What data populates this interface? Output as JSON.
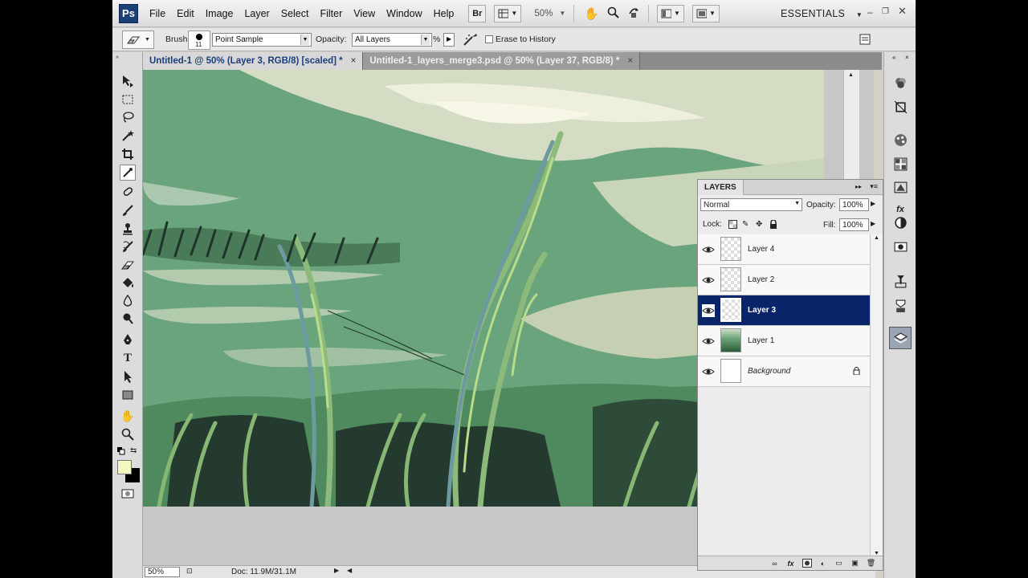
{
  "app": {
    "logo": "Ps",
    "workspace": "ESSENTIALS"
  },
  "menu": [
    "File",
    "Edit",
    "Image",
    "Layer",
    "Select",
    "Filter",
    "View",
    "Window",
    "Help"
  ],
  "appbar": {
    "bridge_label": "Br",
    "zoom": "50%"
  },
  "options": {
    "brush_label": "Brush:",
    "brush_size": "11",
    "sample_value": "Point Sample",
    "opacity_label": "Opacity:",
    "opacity_value": "All Layers",
    "opacity_unit": "%",
    "erase_history_label": "Erase to History"
  },
  "tabs": [
    {
      "label": "Untitled-1 @ 50% (Layer 3, RGB/8) [scaled] *",
      "close": "×"
    },
    {
      "label": "Untitled-1_layers_merge3.psd @ 50% (Layer 37, RGB/8) *",
      "close": "×"
    }
  ],
  "status": {
    "zoom": "50%",
    "doc": "Doc: 11.9M/31.1M"
  },
  "layers_panel": {
    "title": "LAYERS",
    "blend_mode": "Normal",
    "opacity_label": "Opacity:",
    "opacity": "100%",
    "lock_label": "Lock:",
    "fill_label": "Fill:",
    "fill": "100%",
    "layers": [
      {
        "name": "Layer 4",
        "selected": false,
        "thumb": "checker",
        "italic": false,
        "locked": false
      },
      {
        "name": "Layer 2",
        "selected": false,
        "thumb": "checker",
        "italic": false,
        "locked": false
      },
      {
        "name": "Layer 3",
        "selected": true,
        "thumb": "checker",
        "italic": false,
        "locked": false
      },
      {
        "name": "Layer 1",
        "selected": false,
        "thumb": "scene",
        "italic": false,
        "locked": false
      },
      {
        "name": "Background",
        "selected": false,
        "thumb": "white",
        "italic": true,
        "locked": true
      }
    ]
  },
  "colors": {
    "foreground": "#f5f9c0",
    "background": "#000000",
    "selection": "#0a246a",
    "canvas_green": "#6aa47c"
  }
}
